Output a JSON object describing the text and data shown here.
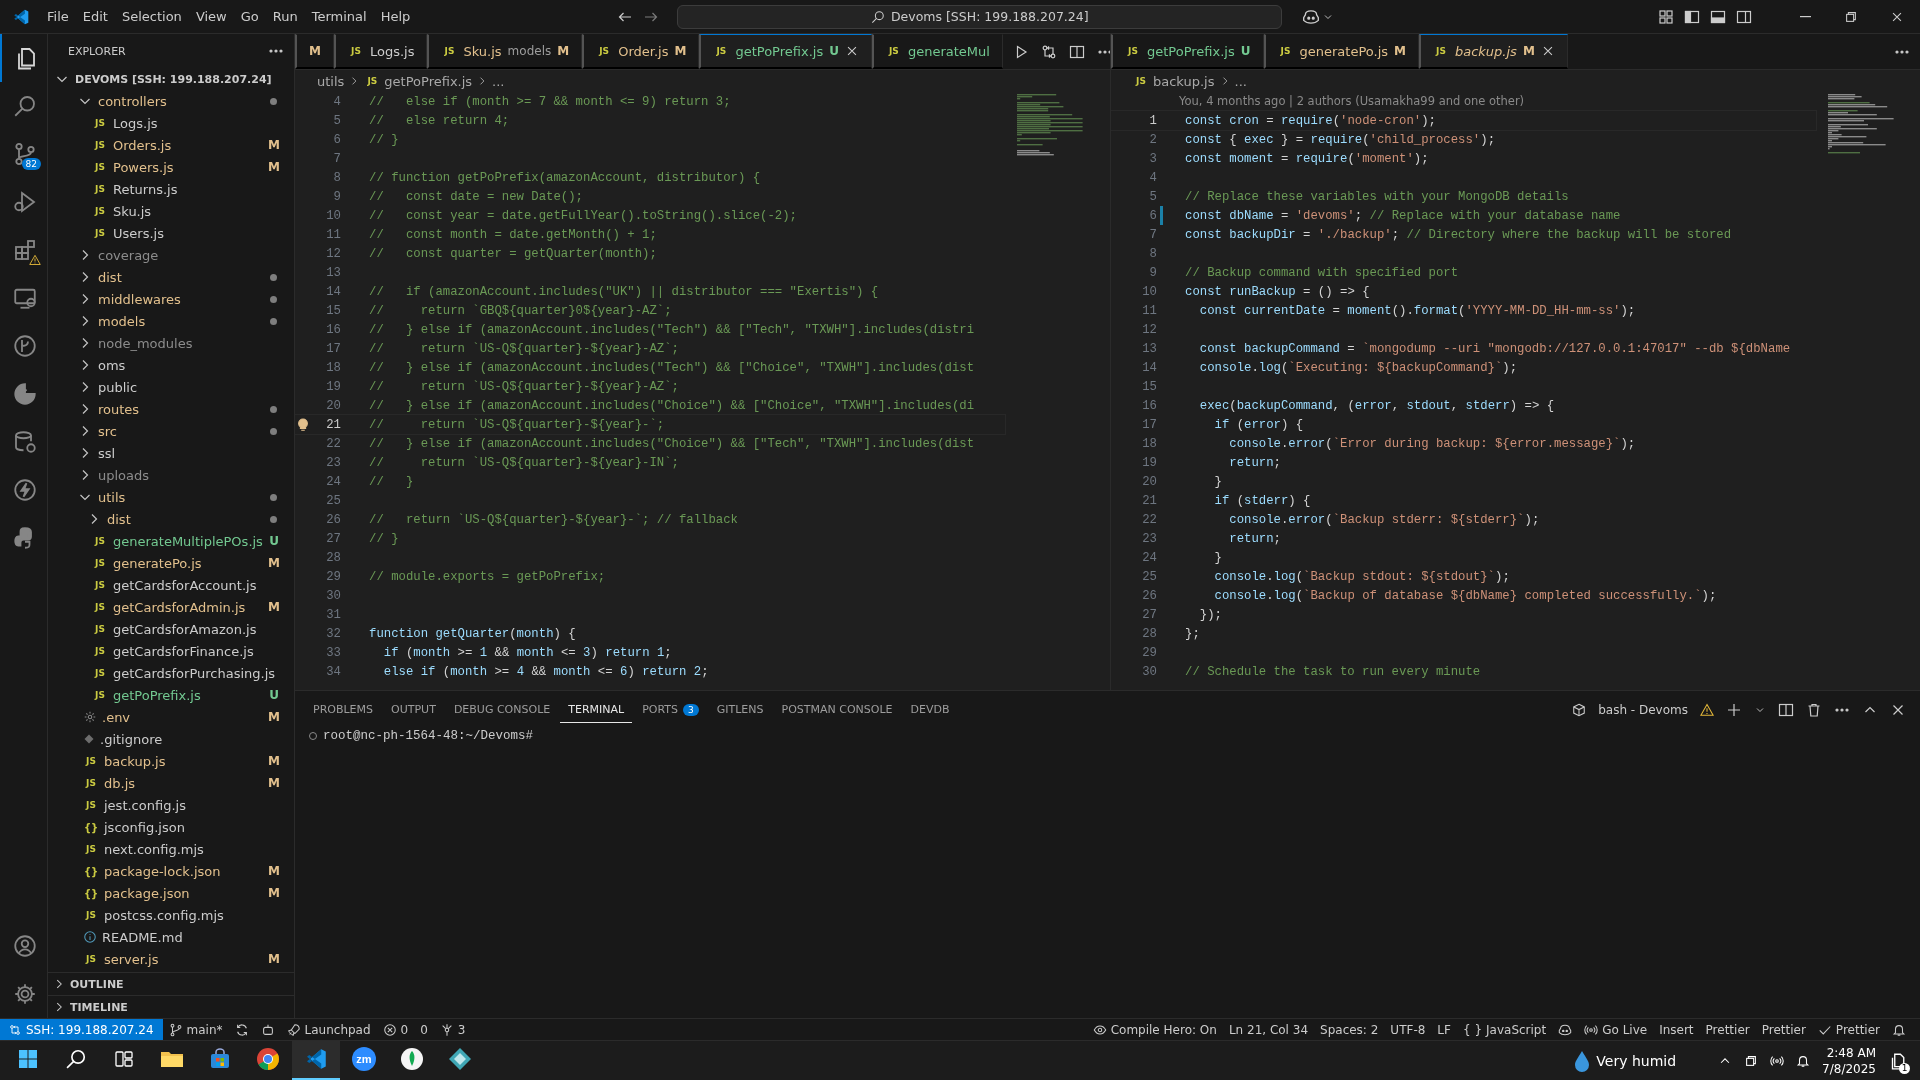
{
  "title_bar": {
    "menu": [
      "File",
      "Edit",
      "Selection",
      "View",
      "Go",
      "Run",
      "Terminal",
      "Help"
    ],
    "command_center": "Devoms [SSH: 199.188.207.24]"
  },
  "activity_bar": {
    "top": [
      {
        "kind": "files",
        "selected": true
      },
      {
        "kind": "search",
        "selected": false
      },
      {
        "kind": "source-control",
        "selected": false,
        "badge": "82"
      },
      {
        "kind": "run-debug",
        "selected": false
      },
      {
        "kind": "extensions",
        "selected": false,
        "warning": true
      },
      {
        "kind": "monitor",
        "selected": false
      },
      {
        "kind": "branch-circle",
        "selected": false
      },
      {
        "kind": "pie",
        "selected": false
      },
      {
        "kind": "cylinder",
        "selected": false
      },
      {
        "kind": "lightning",
        "selected": false
      },
      {
        "kind": "python",
        "selected": false
      }
    ],
    "bottom": [
      {
        "kind": "account",
        "selected": false
      },
      {
        "kind": "gear",
        "selected": false
      }
    ]
  },
  "explorer": {
    "title": "EXPLORER",
    "root": "DEVOMS [SSH: 199.188.207.24]",
    "items": [
      {
        "kind": "folder",
        "name": "controllers",
        "expanded": true,
        "color": "#e2c08d",
        "has_changes": true,
        "children": [
          {
            "kind": "js",
            "icon": "JS",
            "name": "Logs.js",
            "color": "#cccccc"
          },
          {
            "kind": "js",
            "icon": "JS",
            "name": "Orders.js",
            "color": "#e2c08d",
            "badge": "M"
          },
          {
            "kind": "js",
            "icon": "JS",
            "name": "Powers.js",
            "color": "#e2c08d",
            "badge": "M"
          },
          {
            "kind": "js",
            "icon": "JS",
            "name": "Returns.js",
            "color": "#cccccc"
          },
          {
            "kind": "js",
            "icon": "JS",
            "name": "Sku.js",
            "color": "#cccccc"
          },
          {
            "kind": "js",
            "icon": "JS",
            "name": "Users.js",
            "color": "#cccccc"
          }
        ]
      },
      {
        "kind": "folder",
        "name": "coverage",
        "expanded": false,
        "color": "#8c8c8c",
        "has_changes": false
      },
      {
        "kind": "folder",
        "name": "dist",
        "expanded": false,
        "color": "#e2c08d",
        "has_changes": true
      },
      {
        "kind": "folder",
        "name": "middlewares",
        "expanded": false,
        "color": "#e2c08d",
        "has_changes": true
      },
      {
        "kind": "folder",
        "name": "models",
        "expanded": false,
        "color": "#e2c08d",
        "has_changes": true
      },
      {
        "kind": "folder",
        "name": "node_modules",
        "expanded": false,
        "color": "#8c8c8c",
        "has_changes": false
      },
      {
        "kind": "folder",
        "name": "oms",
        "expanded": false,
        "color": "#cccccc",
        "has_changes": false
      },
      {
        "kind": "folder",
        "name": "public",
        "expanded": false,
        "color": "#cccccc",
        "has_changes": false
      },
      {
        "kind": "folder",
        "name": "routes",
        "expanded": false,
        "color": "#e2c08d",
        "has_changes": true
      },
      {
        "kind": "folder",
        "name": "src",
        "expanded": false,
        "color": "#e2c08d",
        "has_changes": true
      },
      {
        "kind": "folder",
        "name": "ssl",
        "expanded": false,
        "color": "#cccccc",
        "has_changes": false
      },
      {
        "kind": "folder",
        "name": "uploads",
        "expanded": false,
        "color": "#8c8c8c",
        "has_changes": false
      },
      {
        "kind": "folder",
        "name": "utils",
        "expanded": true,
        "color": "#e2c08d",
        "has_changes": true,
        "children": [
          {
            "kind": "folder",
            "name": "dist",
            "expanded": false,
            "color": "#e2c08d",
            "has_changes": true
          },
          {
            "kind": "js",
            "icon": "JS",
            "name": "generateMultiplePOs.js",
            "color": "#73c991",
            "badge": "U"
          },
          {
            "kind": "js",
            "icon": "JS",
            "name": "generatePo.js",
            "color": "#e2c08d",
            "badge": "M"
          },
          {
            "kind": "js",
            "icon": "JS",
            "name": "getCardsforAccount.js",
            "color": "#cccccc"
          },
          {
            "kind": "js",
            "icon": "JS",
            "name": "getCardsforAdmin.js",
            "color": "#e2c08d",
            "badge": "M"
          },
          {
            "kind": "js",
            "icon": "JS",
            "name": "getCardsforAmazon.js",
            "color": "#cccccc"
          },
          {
            "kind": "js",
            "icon": "JS",
            "name": "getCardsforFinance.js",
            "color": "#cccccc"
          },
          {
            "kind": "js",
            "icon": "JS",
            "name": "getCardsforPurchasing.js",
            "color": "#cccccc"
          },
          {
            "kind": "js",
            "icon": "JS",
            "name": "getPoPrefix.js",
            "color": "#73c991",
            "badge": "U"
          }
        ]
      },
      {
        "kind": "env",
        "name": ".env",
        "color": "#e2c08d",
        "badge": "M"
      },
      {
        "kind": "git",
        "name": ".gitignore",
        "color": "#cccccc"
      },
      {
        "kind": "js",
        "icon": "JS",
        "name": "backup.js",
        "color": "#e2c08d",
        "badge": "M"
      },
      {
        "kind": "js",
        "icon": "JS",
        "name": "db.js",
        "color": "#e2c08d",
        "badge": "M"
      },
      {
        "kind": "js",
        "icon": "JS",
        "name": "jest.config.js",
        "color": "#cccccc"
      },
      {
        "kind": "json",
        "icon": "{}",
        "name": "jsconfig.json",
        "color": "#cccccc"
      },
      {
        "kind": "js",
        "icon": "JS",
        "name": "next.config.mjs",
        "color": "#cccccc"
      },
      {
        "kind": "json",
        "icon": "{}",
        "name": "package-lock.json",
        "color": "#e2c08d",
        "badge": "M"
      },
      {
        "kind": "json",
        "icon": "{}",
        "name": "package.json",
        "color": "#e2c08d",
        "badge": "M"
      },
      {
        "kind": "js",
        "icon": "JS",
        "name": "postcss.config.mjs",
        "color": "#cccccc"
      },
      {
        "kind": "info",
        "name": "README.md",
        "color": "#cccccc"
      },
      {
        "kind": "js",
        "icon": "JS",
        "name": "server.js",
        "color": "#e2c08d",
        "badge": "M"
      }
    ],
    "sections": [
      "OUTLINE",
      "TIMELINE"
    ]
  },
  "editors": [
    {
      "tabs": [
        {
          "badge": "M",
          "color": "#e2c08d",
          "selected": false
        },
        {
          "icon": "JS",
          "label": "Logs.js",
          "color": "#cccccc",
          "selected": false
        },
        {
          "icon": "JS",
          "label": "Sku.js",
          "description": "models",
          "badge": "M",
          "color": "#e2c08d",
          "selected": false
        },
        {
          "icon": "JS",
          "label": "Order.js",
          "badge": "M",
          "color": "#e2c08d",
          "selected": false
        },
        {
          "icon": "JS",
          "label": "getPoPrefix.js",
          "badge": "U",
          "color": "#73c991",
          "selected": true
        },
        {
          "icon": "JS",
          "label": "generateMul",
          "color": "#73c991",
          "selected": false
        }
      ],
      "actions": true,
      "breadcrumbs": [
        {
          "text": "utils"
        },
        {
          "icon": "JS",
          "text": "getPoPrefix.js"
        },
        {
          "text": "..."
        }
      ],
      "lines": [
        {
          "n": "4",
          "text": "//   else if (month >= 7 && month <= 9) return 3;"
        },
        {
          "n": "5",
          "text": "//   else return 4;"
        },
        {
          "n": "6",
          "text": "// }"
        },
        {
          "n": "7"
        },
        {
          "n": "8",
          "text": "// function getPoPrefix(amazonAccount, distributor) {"
        },
        {
          "n": "9",
          "text": "//   const date = new Date();"
        },
        {
          "n": "10",
          "text": "//   const year = date.getFullYear().toString().slice(-2);"
        },
        {
          "n": "11",
          "text": "//   const month = date.getMonth() + 1;"
        },
        {
          "n": "12",
          "text": "//   const quarter = getQuarter(month);"
        },
        {
          "n": "13"
        },
        {
          "n": "14",
          "text": "//   if (amazonAccount.includes(\"UK\") || distributor === \"Exertis\") {"
        },
        {
          "n": "15",
          "text": "//     return `GBQ${quarter}0${year}-AZ`;"
        },
        {
          "n": "16",
          "text": "//   } else if (amazonAccount.includes(\"Tech\") && [\"Tech\", \"TXWH\"].includes(distri"
        },
        {
          "n": "17",
          "text": "//     return `US-Q${quarter}-${year}-AZ`;"
        },
        {
          "n": "18",
          "text": "//   } else if (amazonAccount.includes(\"Tech\") && [\"Choice\", \"TXWH\"].includes(dist"
        },
        {
          "n": "19",
          "text": "//     return `US-Q${quarter}-${year}-AZ`;"
        },
        {
          "n": "20",
          "text": "//   } else if (amazonAccount.includes(\"Choice\") && [\"Choice\", \"TXWH\"].includes(di"
        },
        {
          "n": "21",
          "text": "//     return `US-Q${quarter}-${year}-`;",
          "current": true,
          "lightbulb": true
        },
        {
          "n": "22",
          "text": "//   } else if (amazonAccount.includes(\"Choice\") && [\"Tech\", \"TXWH\"].includes(dist"
        },
        {
          "n": "23",
          "text": "//     return `US-Q${quarter}-${year}-IN`;"
        },
        {
          "n": "24",
          "text": "//   }"
        },
        {
          "n": "25"
        },
        {
          "n": "26",
          "text": "//   return `US-Q${quarter}-${year}-`; // fallback"
        },
        {
          "n": "27",
          "text": "// }"
        },
        {
          "n": "28"
        },
        {
          "n": "29",
          "text": "// module.exports = getPoPrefix;"
        },
        {
          "n": "30"
        },
        {
          "n": "31"
        },
        {
          "n": "32",
          "text": "function getQuarter(month) {"
        },
        {
          "n": "33",
          "text": "  if (month >= 1 && month <= 3) return 1;"
        },
        {
          "n": "34",
          "text": "  else if (month >= 4 && month <= 6) return 2;"
        }
      ]
    },
    {
      "tabs": [
        {
          "icon": "JS",
          "label": "getPoPrefix.js",
          "badge": "U",
          "color": "#73c991",
          "selected": false,
          "preview": false
        },
        {
          "icon": "JS",
          "label": "generatePo.js",
          "badge": "M",
          "color": "#e2c08d",
          "selected": false,
          "preview": false
        },
        {
          "icon": "JS",
          "label": "backup.js",
          "badge": "M",
          "color": "#e2c08d",
          "selected": true,
          "preview": true
        }
      ],
      "actions": false,
      "breadcrumbs": [
        {
          "icon": "JS",
          "text": "backup.js"
        },
        {
          "text": "..."
        }
      ],
      "blame": "You, 4 months ago | 2 authors (Usamakha99 and one other)",
      "lines": [
        {
          "n": "1",
          "text": "const cron = require('node-cron');",
          "current": true
        },
        {
          "n": "2",
          "text": "const { exec } = require('child_process');"
        },
        {
          "n": "3",
          "text": "const moment = require('moment');"
        },
        {
          "n": "4"
        },
        {
          "n": "5",
          "text": "// Replace these variables with your MongoDB details"
        },
        {
          "n": "6",
          "text": "const dbName = 'devoms'; // Replace with your database name",
          "changed": true
        },
        {
          "n": "7",
          "text": "const backupDir = './backup'; // Directory where the backup will be stored"
        },
        {
          "n": "8"
        },
        {
          "n": "9",
          "text": "// Backup command with specified port"
        },
        {
          "n": "10",
          "text": "const runBackup = () => {"
        },
        {
          "n": "11",
          "text": "  const currentDate = moment().format('YYYY-MM-DD_HH-mm-ss');"
        },
        {
          "n": "12"
        },
        {
          "n": "13",
          "text": "  const backupCommand = `mongodump --uri \"mongodb://127.0.0.1:47017\" --db ${dbName"
        },
        {
          "n": "14",
          "text": "  console.log(`Executing: ${backupCommand}`);"
        },
        {
          "n": "15"
        },
        {
          "n": "16",
          "text": "  exec(backupCommand, (error, stdout, stderr) => {"
        },
        {
          "n": "17",
          "text": "    if (error) {"
        },
        {
          "n": "18",
          "text": "      console.error(`Error during backup: ${error.message}`);"
        },
        {
          "n": "19",
          "text": "      return;"
        },
        {
          "n": "20",
          "text": "    }"
        },
        {
          "n": "21",
          "text": "    if (stderr) {"
        },
        {
          "n": "22",
          "text": "      console.error(`Backup stderr: ${stderr}`);"
        },
        {
          "n": "23",
          "text": "      return;"
        },
        {
          "n": "24",
          "text": "    }"
        },
        {
          "n": "25",
          "text": "    console.log(`Backup stdout: ${stdout}`);"
        },
        {
          "n": "26",
          "text": "    console.log(`Backup of database ${dbName} completed successfully.`);"
        },
        {
          "n": "27",
          "text": "  });"
        },
        {
          "n": "28",
          "text": "};"
        },
        {
          "n": "29"
        },
        {
          "n": "30",
          "text": "// Schedule the task to run every minute"
        }
      ]
    }
  ],
  "panel": {
    "tabs": [
      {
        "label": "PROBLEMS",
        "selected": false
      },
      {
        "label": "OUTPUT",
        "selected": false
      },
      {
        "label": "DEBUG CONSOLE",
        "selected": false
      },
      {
        "label": "TERMINAL",
        "selected": true
      },
      {
        "label": "PORTS",
        "selected": false,
        "badge": "3"
      },
      {
        "label": "GITLENS",
        "selected": false
      },
      {
        "label": "POSTMAN CONSOLE",
        "selected": false
      },
      {
        "label": "DEVDB",
        "selected": false
      }
    ],
    "terminal_name": "bash - Devoms",
    "prompt": "root@nc-ph-1564-48:~/Devoms#"
  },
  "status_bar": {
    "remote": "SSH: 199.188.207.24",
    "left": [
      {
        "kind": "branch",
        "text": "main*"
      },
      {
        "kind": "sync"
      },
      {
        "kind": "robot"
      },
      {
        "kind": "rocket",
        "text": "Launchpad"
      },
      {
        "kind": "errors",
        "text": "0"
      },
      {
        "kind": "warnings",
        "text": "0"
      },
      {
        "kind": "ports",
        "text": "3"
      }
    ],
    "right": [
      {
        "kind": "eye",
        "text": "Compile Hero: On"
      },
      {
        "kind": "plain",
        "text": "Ln 21, Col 34"
      },
      {
        "kind": "plain",
        "text": "Spaces: 2"
      },
      {
        "kind": "plain",
        "text": "UTF-8"
      },
      {
        "kind": "plain",
        "text": "LF"
      },
      {
        "kind": "braces",
        "text": "JavaScript",
        "glyph": "{ }"
      },
      {
        "kind": "goggles"
      },
      {
        "kind": "radio",
        "text": "Go Live"
      },
      {
        "kind": "plain",
        "text": "Insert"
      },
      {
        "kind": "plain",
        "text": "Prettier"
      },
      {
        "kind": "plain",
        "text": "Prettier"
      },
      {
        "kind": "check",
        "text": "Prettier"
      },
      {
        "kind": "bell"
      }
    ]
  },
  "taskbar": {
    "apps": [
      {
        "kind": "start",
        "selected": false
      },
      {
        "kind": "search",
        "selected": false
      },
      {
        "kind": "task-view",
        "selected": false
      },
      {
        "kind": "folder",
        "selected": false
      },
      {
        "kind": "store",
        "selected": false
      },
      {
        "kind": "chrome",
        "selected": false
      },
      {
        "kind": "vscode",
        "selected": true
      },
      {
        "kind": "zoom",
        "label": "zm",
        "selected": false
      },
      {
        "kind": "leaf",
        "selected": false
      },
      {
        "kind": "diamond",
        "selected": false
      }
    ],
    "weather": "Very humid",
    "time": "2:48 AM",
    "date": "7/8/2025",
    "notifications": "1"
  }
}
